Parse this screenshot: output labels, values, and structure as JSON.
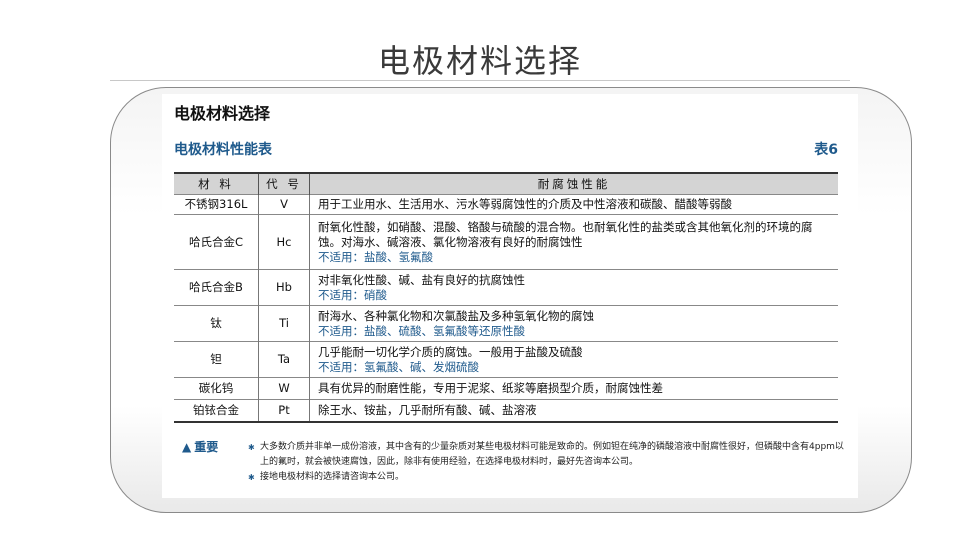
{
  "slide": {
    "title": "电极材料选择"
  },
  "document": {
    "heading": "电极材料选择",
    "table_caption": "电极材料性能表",
    "table_number": "表6",
    "columns": [
      "材 料",
      "代 号",
      "耐腐蚀性能"
    ],
    "rows": [
      {
        "material": "不锈钢316L",
        "code": "V",
        "description": "用于工业用水、生活用水、污水等弱腐蚀性的介质及中性溶液和碳酸、醋酸等弱酸",
        "not_suitable": ""
      },
      {
        "material": "哈氏合金C",
        "code": "Hc",
        "description": "耐氧化性酸，如硝酸、混酸、铬酸与硫酸的混合物。也耐氧化性的盐类或含其他氧化剂的环境的腐蚀。对海水、碱溶液、氯化物溶液有良好的耐腐蚀性",
        "not_suitable": "不适用：盐酸、氢氟酸"
      },
      {
        "material": "哈氏合金B",
        "code": "Hb",
        "description": "对非氧化性酸、碱、盐有良好的抗腐蚀性",
        "not_suitable": "不适用：硝酸"
      },
      {
        "material": "钛",
        "code": "Ti",
        "description": "耐海水、各种氯化物和次氯酸盐及多种氢氧化物的腐蚀",
        "not_suitable": "不适用：盐酸、硫酸、氢氟酸等还原性酸"
      },
      {
        "material": "钽",
        "code": "Ta",
        "description": "几乎能耐一切化学介质的腐蚀。一般用于盐酸及硫酸",
        "not_suitable": "不适用：氢氟酸、碱、发烟硫酸"
      },
      {
        "material": "碳化钨",
        "code": "W",
        "description": "具有优异的耐磨性能，专用于泥浆、纸浆等磨损型介质，耐腐蚀性差",
        "not_suitable": ""
      },
      {
        "material": "铂铱合金",
        "code": "Pt",
        "description": "除王水、铵盐，几乎耐所有酸、碱、盐溶液",
        "not_suitable": ""
      }
    ],
    "notes_label": "重要",
    "notes": [
      "大多数介质并非单一成份溶液，其中含有的少量杂质对某些电极材料可能是致命的。例如钽在纯净的磷酸溶液中耐腐性很好，但磷酸中含有4ppm以上的氟时，就会被快速腐蚀，因此，除非有使用经验，在选择电极材料时，最好先咨询本公司。",
      "接地电极材料的选择请咨询本公司。"
    ]
  }
}
